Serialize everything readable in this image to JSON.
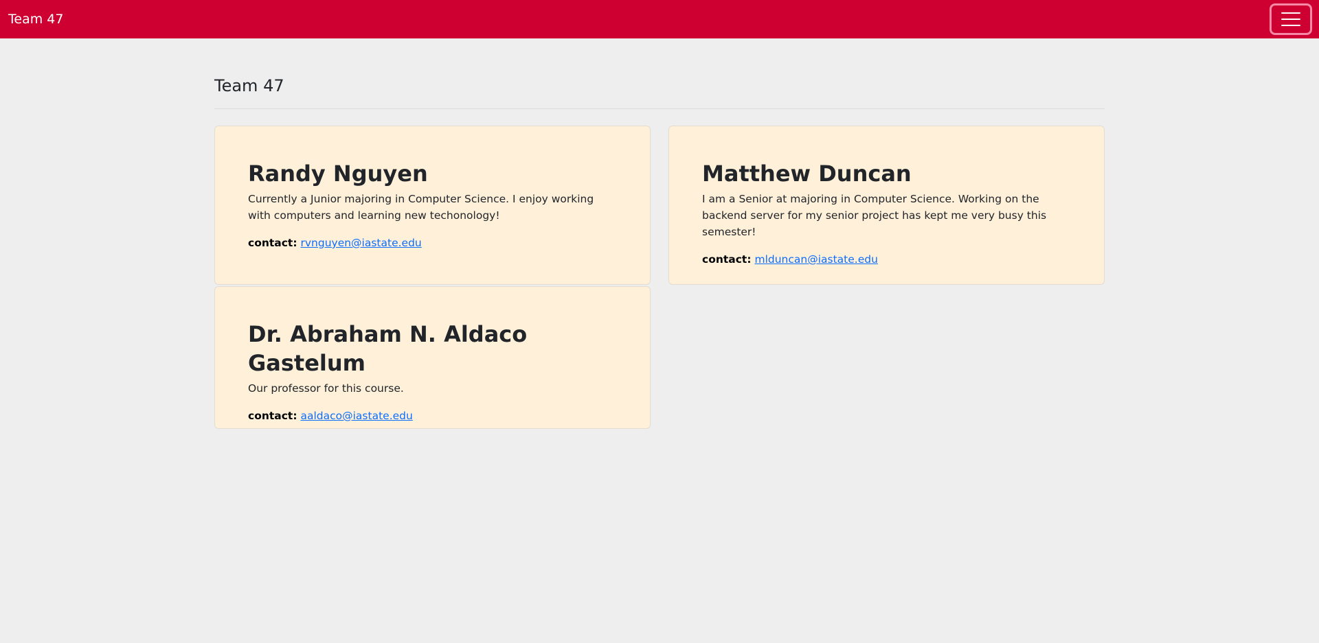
{
  "navbar": {
    "brand": "Team 47",
    "menu_icon": "hamburger-menu-icon",
    "bg_color": "#ce0032"
  },
  "page": {
    "title": "Team 47"
  },
  "members": [
    {
      "name": "Randy Nguyen",
      "bio": "Currently a Junior majoring in Computer Science. I enjoy working with computers and learning new techonology!",
      "contact_label": "contact:",
      "email": "rvnguyen@iastate.edu"
    },
    {
      "name": "Matthew Duncan",
      "bio": "I am a Senior at majoring in Computer Science. Working on the backend server for my senior project has kept me very busy this semester!",
      "contact_label": "contact:",
      "email": "mlduncan@iastate.edu"
    },
    {
      "name": "Dr. Abraham N. Aldaco Gastelum",
      "bio": "Our professor for this course.",
      "contact_label": "contact:",
      "email": "aaldaco@iastate.edu"
    }
  ],
  "colors": {
    "card_bg": "#fff0da",
    "page_bg": "#eeeeee",
    "link": "#0d6efd"
  }
}
